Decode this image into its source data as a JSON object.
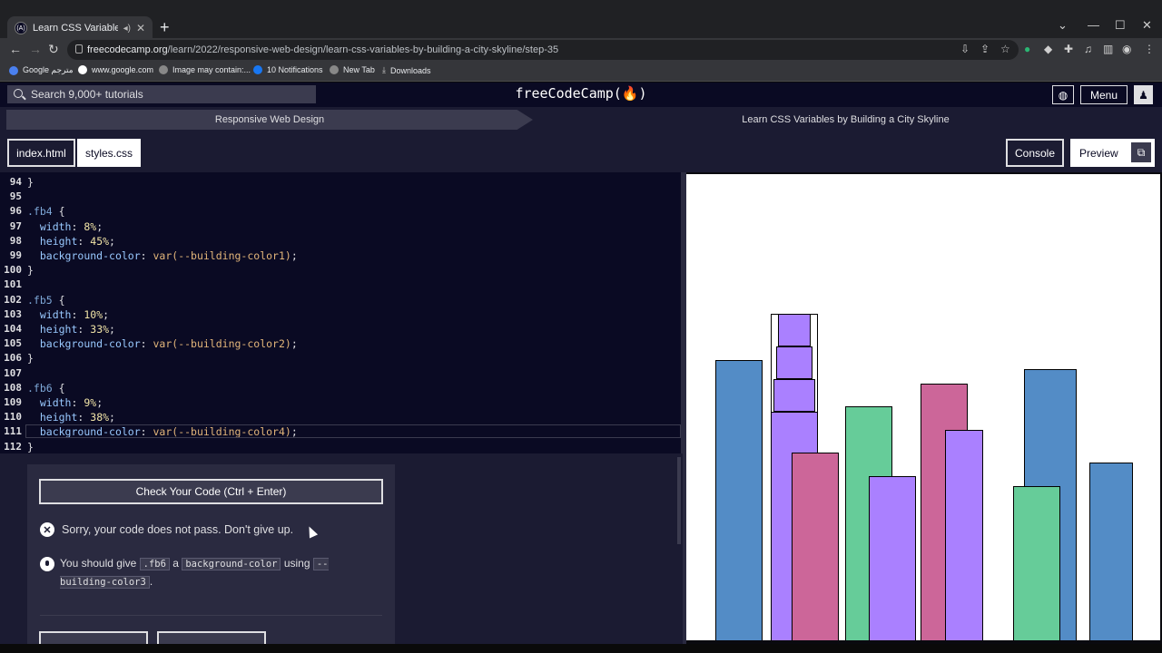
{
  "browser": {
    "tab_title": "Learn CSS Variables by Build",
    "tab_favicon": "(A)",
    "url_host": "freecodecamp.org",
    "url_path": "/learn/2022/responsive-web-design/learn-css-variables-by-building-a-city-skyline/step-35",
    "bookmarks": [
      {
        "label": "Google مترجم",
        "icon": "translate-icon"
      },
      {
        "label": "www.google.com",
        "icon": "google-icon"
      },
      {
        "label": "Image may contain:...",
        "icon": "globe-icon"
      },
      {
        "label": "10 Notifications",
        "icon": "facebook-icon"
      },
      {
        "label": "New Tab",
        "icon": "globe-icon"
      },
      {
        "label": "Downloads",
        "icon": "download-icon"
      }
    ]
  },
  "nav": {
    "search_placeholder": "Search 9,000+ tutorials",
    "logo": "freeCodeCamp(🔥)",
    "menu_label": "Menu"
  },
  "breadcrumb": {
    "course": "Responsive Web Design",
    "project": "Learn CSS Variables by Building a City Skyline"
  },
  "files": {
    "tab_html": "index.html",
    "tab_css": "styles.css",
    "console_label": "Console",
    "preview_label": "Preview"
  },
  "editor": {
    "lines": [
      {
        "n": "94",
        "text": "}"
      },
      {
        "n": "95",
        "text": ""
      },
      {
        "n": "96",
        "text": ".fb4 {"
      },
      {
        "n": "97",
        "text": "  width: 8%;"
      },
      {
        "n": "98",
        "text": "  height: 45%;"
      },
      {
        "n": "99",
        "text": "  background-color: var(--building-color1);"
      },
      {
        "n": "100",
        "text": "}"
      },
      {
        "n": "101",
        "text": ""
      },
      {
        "n": "102",
        "text": ".fb5 {"
      },
      {
        "n": "103",
        "text": "  width: 10%;"
      },
      {
        "n": "104",
        "text": "  height: 33%;"
      },
      {
        "n": "105",
        "text": "  background-color: var(--building-color2);"
      },
      {
        "n": "106",
        "text": "}"
      },
      {
        "n": "107",
        "text": ""
      },
      {
        "n": "108",
        "text": ".fb6 {"
      },
      {
        "n": "109",
        "text": "  width: 9%;"
      },
      {
        "n": "110",
        "text": "  height: 38%;"
      },
      {
        "n": "111",
        "text": "  background-color: var(--building-color4);"
      },
      {
        "n": "112",
        "text": "}"
      }
    ]
  },
  "instructions": {
    "check_button": "Check Your Code (Ctrl + Enter)",
    "error_message": "Sorry, your code does not pass. Don't give up.",
    "hint_prefix": "You should give",
    "hint_chip1": ".fb6",
    "hint_mid1": "a",
    "hint_chip2": "background-color",
    "hint_mid2": "using",
    "hint_chip3": "--building-color3",
    "hint_suffix": "."
  },
  "colors": {
    "building_color1": "#aa80ff",
    "building_color2": "#66cc99",
    "building_color3": "#cc6699",
    "building_color4": "#538cc6"
  }
}
